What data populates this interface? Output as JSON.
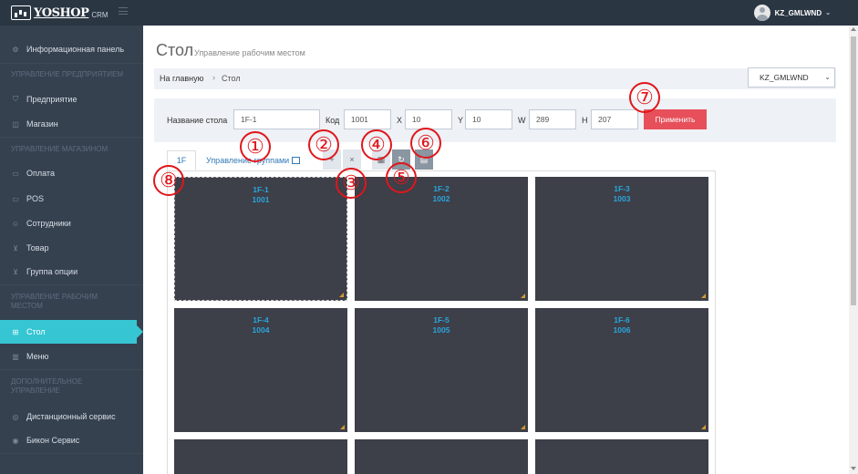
{
  "app": {
    "logo_text": "YOSHOP",
    "logo_sub": "CRM",
    "user_name": "KZ_GMLWND",
    "user_chevron": "⌄"
  },
  "sidebar": {
    "items": [
      {
        "label": "Информационная панель",
        "icon": "dashboard-icon"
      },
      {
        "label": "Предприятие",
        "icon": "shield-icon"
      },
      {
        "label": "Магазин",
        "icon": "store-icon"
      },
      {
        "label": "Оплата",
        "icon": "card-icon"
      },
      {
        "label": "POS",
        "icon": "pos-icon"
      },
      {
        "label": "Сотрудники",
        "icon": "users-icon"
      },
      {
        "label": "Товар",
        "icon": "cart-icon"
      },
      {
        "label": "Группа опции",
        "icon": "cart-icon"
      },
      {
        "label": "Стол",
        "icon": "grid-icon",
        "active": true
      },
      {
        "label": "Меню",
        "icon": "book-icon"
      },
      {
        "label": "Дистанционный сервис",
        "icon": "remote-icon"
      },
      {
        "label": "Бикон Сервис",
        "icon": "pin-icon"
      }
    ],
    "sections": [
      "УПРАВЛЕНИЕ ПРЕДПРИЯТИЕМ",
      "УПРАВЛЕНИЕ МАГАЗИНОМ",
      "УПРАВЛЕНИЕ РАБОЧИМ МЕСТОМ",
      "ДОПОЛНИТЕЛЬНОЕ УПРАВЛЕНИЕ"
    ]
  },
  "page": {
    "title": "Стол",
    "subtitle": "Управление рабочим местом",
    "breadcrumb_home": "На главную",
    "breadcrumb_sep": "›",
    "breadcrumb_current": "Стол",
    "store_selected": "KZ_GMLWND"
  },
  "form": {
    "name_label": "Название стола",
    "name_value": "1F-1",
    "code_label": "Код",
    "code_value": "1001",
    "x_label": "X",
    "x_value": "10",
    "y_label": "Y",
    "y_value": "10",
    "w_label": "W",
    "w_value": "289",
    "h_label": "H",
    "h_value": "207",
    "apply_label": "Применить"
  },
  "tabs": {
    "floor": "1F",
    "group": "Управление группами"
  },
  "toolbar": {
    "add": "+",
    "delete": "×",
    "grid": "▦",
    "refresh": "↻",
    "save": "▤"
  },
  "tables": [
    {
      "name": "1F-1",
      "code": "1001",
      "selected": true
    },
    {
      "name": "1F-2",
      "code": "1002"
    },
    {
      "name": "1F-3",
      "code": "1003"
    },
    {
      "name": "1F-4",
      "code": "1004"
    },
    {
      "name": "1F-5",
      "code": "1005"
    },
    {
      "name": "1F-6",
      "code": "1006"
    }
  ],
  "callouts": [
    "①",
    "②",
    "③",
    "④",
    "⑤",
    "⑥",
    "⑦",
    "⑧"
  ],
  "colors": {
    "accent": "#36c6d3",
    "apply": "#e7505a",
    "table_bg": "#3d3f49",
    "table_text": "#2ba5db",
    "callout": "#e0161b"
  }
}
